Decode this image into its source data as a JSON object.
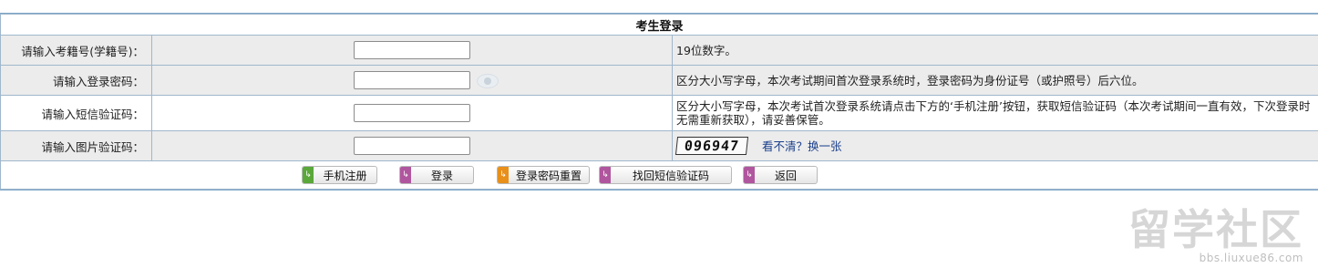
{
  "title": "考生登录",
  "rows": [
    {
      "label": "请输入考籍号(学籍号)：",
      "placeholder": "",
      "value": "",
      "desc": "19位数字。"
    },
    {
      "label": "请输入登录密码：",
      "placeholder": "",
      "value": "",
      "desc": "区分大小写字母，本次考试期间首次登录系统时，登录密码为身份证号（或护照号）后六位。"
    },
    {
      "label": "请输入短信验证码：",
      "placeholder": "",
      "value": "",
      "desc": "区分大小写字母，本次考试首次登录系统请点击下方的‘手机注册’按钮，获取短信验证码（本次考试期间一直有效，下次登录时无需重新获取），请妥善保管。"
    },
    {
      "label": "请输入图片验证码：",
      "placeholder": "",
      "value": ""
    }
  ],
  "captcha": {
    "text": "096947",
    "refresh_link": "看不清？换一张"
  },
  "buttons": [
    {
      "label": "手机注册",
      "color": "#5aa83a"
    },
    {
      "label": "登录",
      "color": "#b0569e"
    },
    {
      "label": "登录密码重置",
      "color": "#e8901a"
    },
    {
      "label": "找回短信验证码",
      "color": "#b0569e"
    },
    {
      "label": "返回",
      "color": "#b0569e"
    }
  ],
  "watermark": {
    "main": "留学社区",
    "url": "bbs.liuxue86.com"
  }
}
